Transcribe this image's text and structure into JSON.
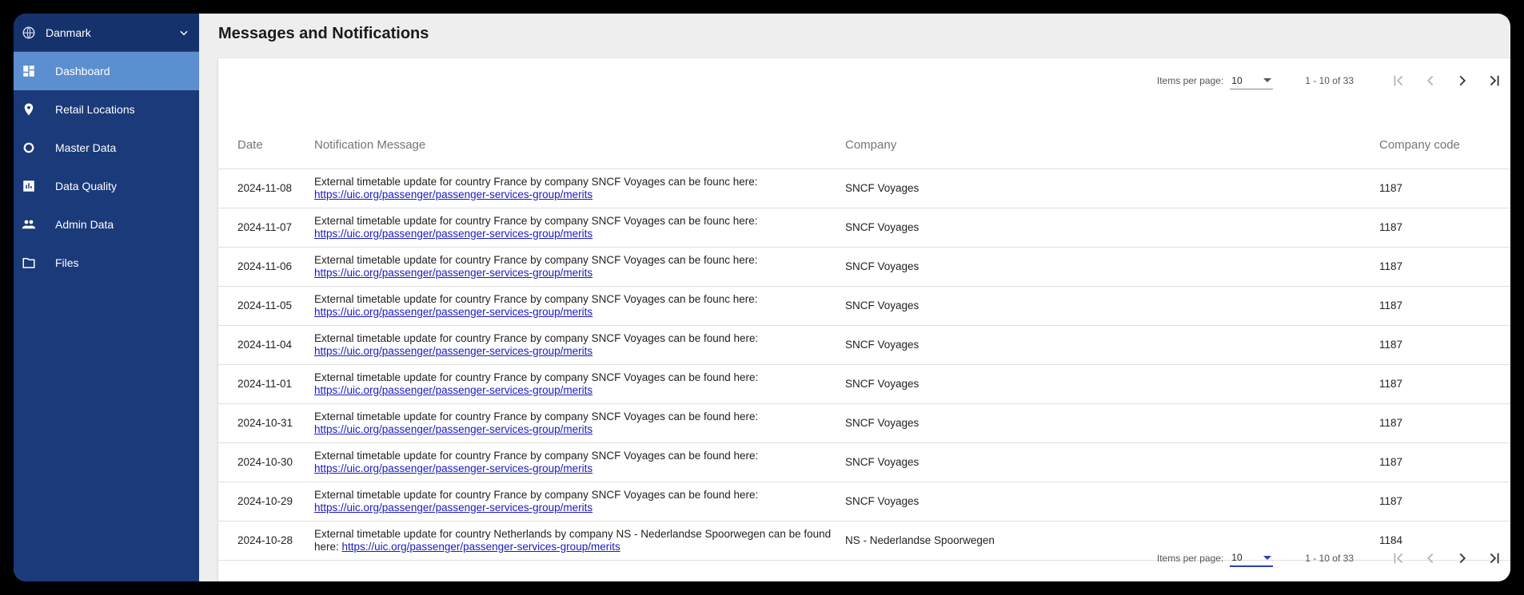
{
  "sidebar": {
    "country": "Danmark",
    "items": [
      {
        "label": "Dashboard",
        "icon": "dashboard-icon",
        "active": true
      },
      {
        "label": "Retail Locations",
        "icon": "location-pin-icon",
        "active": false
      },
      {
        "label": "Master Data",
        "icon": "circle-icon",
        "active": false
      },
      {
        "label": "Data Quality",
        "icon": "bar-chart-icon",
        "active": false
      },
      {
        "label": "Admin Data",
        "icon": "people-icon",
        "active": false
      },
      {
        "label": "Files",
        "icon": "folder-icon",
        "active": false
      }
    ]
  },
  "page": {
    "title": "Messages and Notifications"
  },
  "paginator": {
    "items_label": "Items per page:",
    "page_size": "10",
    "range": "1 - 10 of 33"
  },
  "table": {
    "headers": [
      "Date",
      "Notification Message",
      "Company",
      "Company code"
    ],
    "rows": [
      {
        "date": "2024-11-08",
        "msg": "External timetable update for country France by company SNCF Voyages can be founc here:",
        "link": "https://uic.org/passenger/passenger-services-group/merits",
        "company": "SNCF Voyages",
        "code": "1187"
      },
      {
        "date": "2024-11-07",
        "msg": "External timetable update for country France by company SNCF Voyages can be founc here:",
        "link": "https://uic.org/passenger/passenger-services-group/merits",
        "company": "SNCF Voyages",
        "code": "1187"
      },
      {
        "date": "2024-11-06",
        "msg": "External timetable update for country France by company SNCF Voyages can be founc here:",
        "link": "https://uic.org/passenger/passenger-services-group/merits",
        "company": "SNCF Voyages",
        "code": "1187"
      },
      {
        "date": "2024-11-05",
        "msg": "External timetable update for country France by company SNCF Voyages can be founc here:",
        "link": "https://uic.org/passenger/passenger-services-group/merits",
        "company": "SNCF Voyages",
        "code": "1187"
      },
      {
        "date": "2024-11-04",
        "msg": "External timetable update for country France by company SNCF Voyages can be found here:",
        "link": "https://uic.org/passenger/passenger-services-group/merits",
        "company": "SNCF Voyages",
        "code": "1187"
      },
      {
        "date": "2024-11-01",
        "msg": "External timetable update for country France by company SNCF Voyages can be found here:",
        "link": "https://uic.org/passenger/passenger-services-group/merits",
        "company": "SNCF Voyages",
        "code": "1187"
      },
      {
        "date": "2024-10-31",
        "msg": "External timetable update for country France by company SNCF Voyages can be found here:",
        "link": "https://uic.org/passenger/passenger-services-group/merits",
        "company": "SNCF Voyages",
        "code": "1187"
      },
      {
        "date": "2024-10-30",
        "msg": "External timetable update for country France by company SNCF Voyages can be found here:",
        "link": "https://uic.org/passenger/passenger-services-group/merits",
        "company": "SNCF Voyages",
        "code": "1187"
      },
      {
        "date": "2024-10-29",
        "msg": "External timetable update for country France by company SNCF Voyages can be found here:",
        "link": "https://uic.org/passenger/passenger-services-group/merits",
        "company": "SNCF Voyages",
        "code": "1187"
      },
      {
        "date": "2024-10-28",
        "msg": "External timetable update for country Netherlands by company NS - Nederlandse Spoorwegen can be found here:",
        "link": "https://uic.org/passenger/passenger-services-group/merits",
        "company": "NS - Nederlandse Spoorwegen",
        "code": "1184"
      }
    ]
  }
}
